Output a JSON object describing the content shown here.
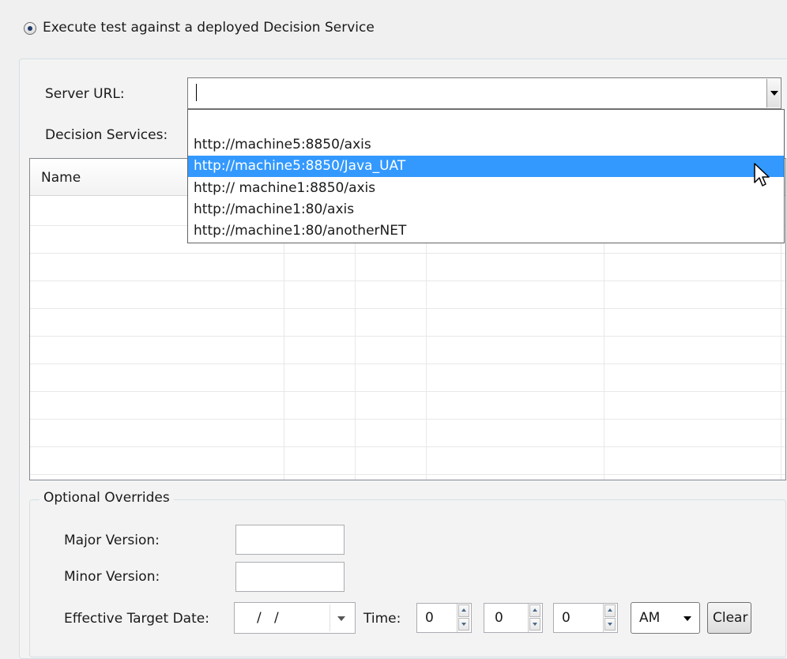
{
  "execute_radio": {
    "label": "Execute test against a deployed Decision Service",
    "selected": true
  },
  "server_url": {
    "label": "Server URL:",
    "value": ""
  },
  "decision_services": {
    "label": "Decision Services:"
  },
  "table": {
    "columns": [
      "Name",
      "",
      "",
      "",
      ""
    ]
  },
  "dropdown": {
    "items": [
      "",
      "http://machine5:8850/axis",
      "http://machine5:8850/Java_UAT",
      "http:// machine1:8850/axis",
      "http://machine1:80/axis",
      "http://machine1:80/anotherNET"
    ],
    "selected_index": 2
  },
  "overrides": {
    "legend": "Optional Overrides",
    "major_version_label": "Major Version:",
    "minor_version_label": "Minor Version:",
    "date_label": "Effective Target Date:",
    "date_value": "/   /",
    "time_label": "Time:",
    "hour": "0",
    "minute": "0",
    "second": "0",
    "ampm": "AM",
    "clear_label": "Clear"
  },
  "icons": [
    "radio-selected-icon",
    "chevron-down-icon",
    "mouse-pointer-icon",
    "spin-up-icon",
    "spin-down-icon"
  ]
}
